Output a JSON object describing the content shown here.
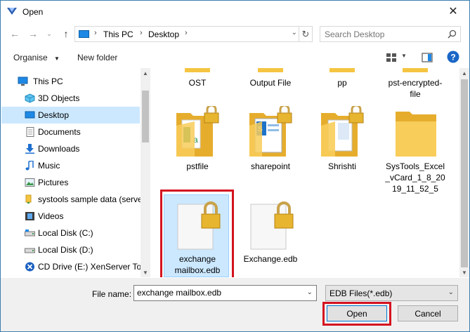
{
  "window": {
    "title": "Open"
  },
  "address": {
    "crumbs": [
      "This PC",
      "Desktop"
    ],
    "search_placeholder": "Search Desktop"
  },
  "toolbar": {
    "organise": "Organise",
    "new_folder": "New folder"
  },
  "nav": {
    "items": [
      {
        "label": "This PC",
        "icon": "computer-icon"
      },
      {
        "label": "3D Objects",
        "icon": "cube-icon"
      },
      {
        "label": "Desktop",
        "icon": "desktop-icon",
        "selected": true
      },
      {
        "label": "Documents",
        "icon": "documents-icon"
      },
      {
        "label": "Downloads",
        "icon": "download-icon"
      },
      {
        "label": "Music",
        "icon": "music-icon"
      },
      {
        "label": "Pictures",
        "icon": "pictures-icon"
      },
      {
        "label": "systools sample data (serve",
        "icon": "network-drive-icon"
      },
      {
        "label": "Videos",
        "icon": "videos-icon"
      },
      {
        "label": "Local Disk (C:)",
        "icon": "disk-icon"
      },
      {
        "label": "Local Disk (D:)",
        "icon": "disk-icon"
      },
      {
        "label": "CD Drive (E:) XenServer Too",
        "icon": "cd-drive-icon"
      }
    ]
  },
  "files": {
    "row1": [
      "OST",
      "Output File",
      "pp",
      "pst-encrypted-\nfile"
    ],
    "row2": [
      "pstfile",
      "sharepoint",
      "Shrishti",
      "SysTools_Excel\n_vCard_1_8_20\n19_11_52_5"
    ],
    "row3": [
      "exchange\nmailbox.edb",
      "Exchange.edb"
    ]
  },
  "footer": {
    "file_name_label": "File name:",
    "file_name_value": "exchange mailbox.edb",
    "filter_value": "EDB Files(*.edb)",
    "open_label": "Open",
    "cancel_label": "Cancel"
  },
  "colors": {
    "accent": "#0078d7",
    "selection": "#cce8ff",
    "highlight_box": "#d4131f",
    "folder": "#f5c542"
  }
}
